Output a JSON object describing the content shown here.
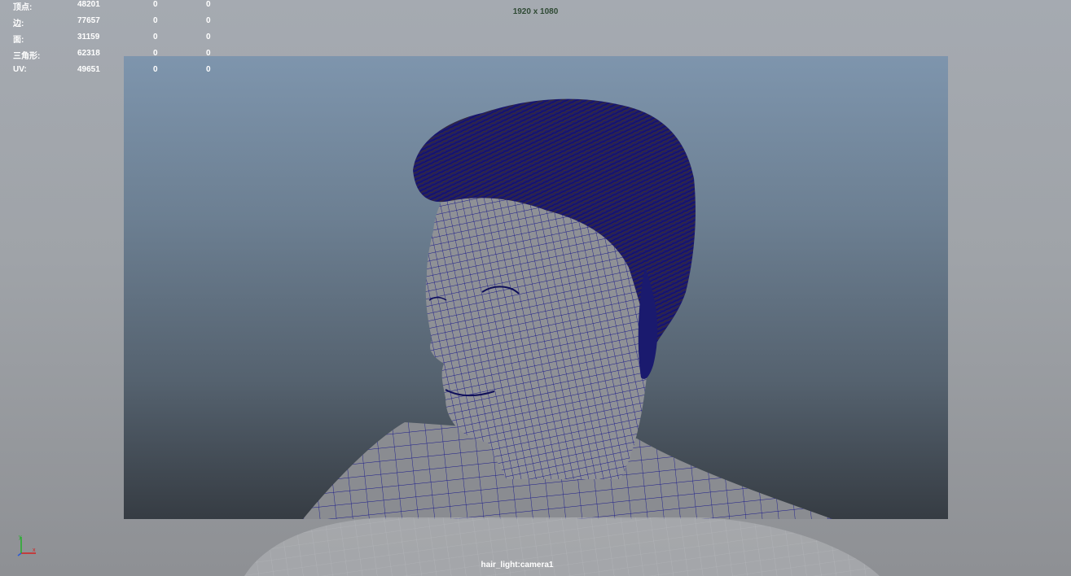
{
  "poly_count": {
    "rows": [
      {
        "label": "顶点:",
        "values": [
          "48201",
          "0",
          "0"
        ]
      },
      {
        "label": "边:",
        "values": [
          "77657",
          "0",
          "0"
        ]
      },
      {
        "label": "面:",
        "values": [
          "31159",
          "0",
          "0"
        ]
      },
      {
        "label": "三角形:",
        "values": [
          "62318",
          "0",
          "0"
        ]
      },
      {
        "label": "UV:",
        "values": [
          "49651",
          "0",
          "0"
        ]
      }
    ]
  },
  "viewport": {
    "resolution": "1920 x 1080",
    "camera_name": "hair_light:camera1",
    "wire_color": "#1a1a8a",
    "mesh_color": "#8f9196"
  },
  "axis_gizmo": {
    "icon": "xyz-axis-icon",
    "x_color": "#d42020",
    "y_color": "#22b02a",
    "z_color": "#2a5ad8"
  }
}
